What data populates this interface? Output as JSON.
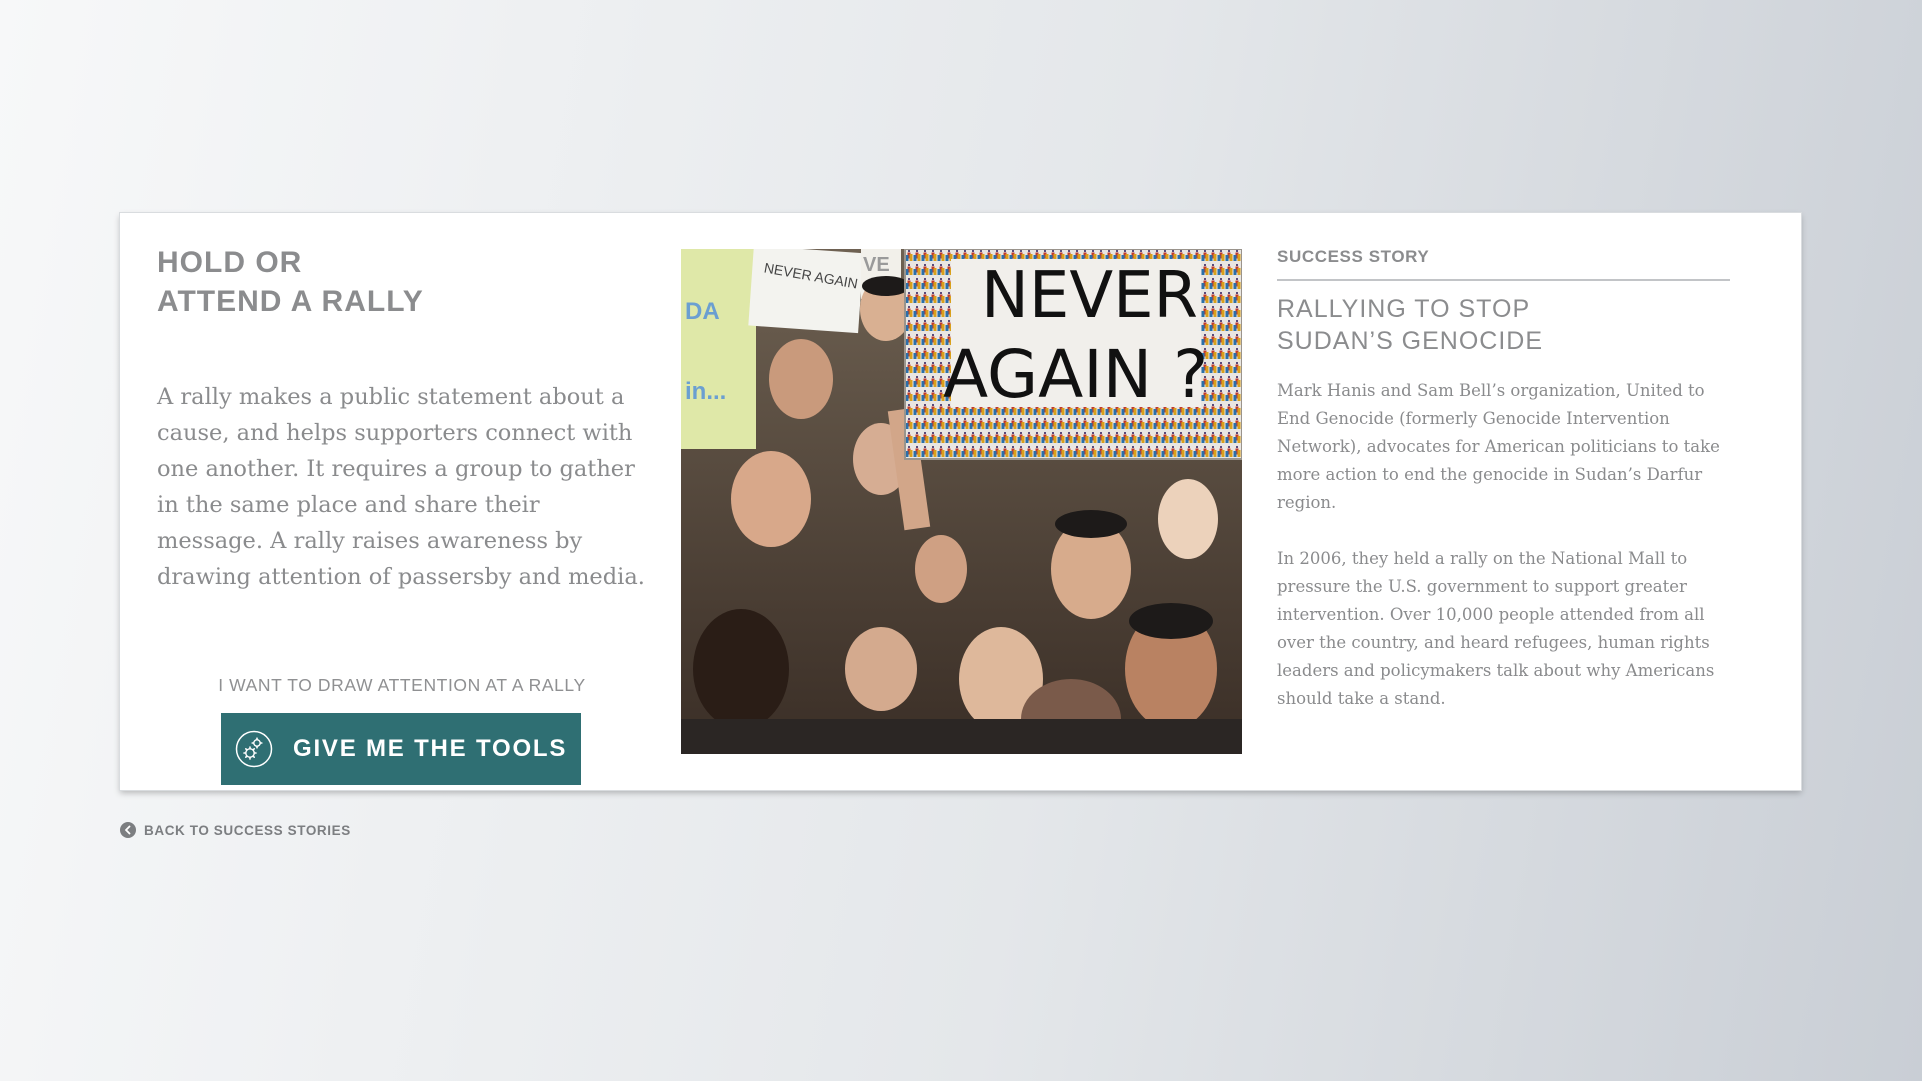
{
  "card": {
    "title_line1": "HOLD OR",
    "title_line2": "ATTEND A RALLY",
    "description": "A rally makes a public statement about a cause, and helps supporters connect with one another. It requires a group to gather in the same place and share their message. A rally raises awareness by drawing attention of passersby and media.",
    "cta_label": "I WANT TO DRAW ATTENTION AT A RALLY",
    "cta_button": "GIVE ME THE TOOLS",
    "cta_icon": "gears-icon"
  },
  "photo": {
    "sign_line1": "NEVER",
    "sign_line2": "AGAIN ?",
    "background_sign_text": "NEVER AGAIN WE CAN'T",
    "side_sign_text_1": "DA",
    "side_sign_text_2": "in...",
    "side_sign_text_3": "VE"
  },
  "story": {
    "kicker": "SUCCESS STORY",
    "title_line1": "RALLYING TO STOP",
    "title_line2": "SUDAN’S GENOCIDE",
    "paragraph1": "Mark Hanis and Sam Bell’s organization, United to End Genocide (formerly Genocide Intervention Network), advocates for American politicians to take more action to end the genocide in Sudan’s Darfur region.",
    "paragraph2": "In 2006, they held a rally on the National Mall to pressure the U.S. government to support greater intervention. Over 10,000 people attended from all over the country, and heard refugees, human rights leaders and policymakers talk about why Americans should take a stand."
  },
  "back": {
    "label": "BACK TO SUCCESS STORIES",
    "icon": "chevron-left-circle-icon"
  },
  "colors": {
    "accent": "#2f6f73",
    "text_gray": "#8b8c8e",
    "card_bg": "#ffffff"
  }
}
